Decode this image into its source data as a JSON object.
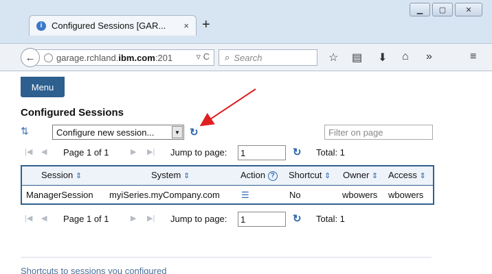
{
  "browser": {
    "tab_title": "Configured Sessions [GAR...",
    "tab_close": "×",
    "new_tab": "+",
    "url_prefix": "garage.rchland.",
    "url_host": "ibm.com",
    "url_suffix": ":201",
    "search_placeholder": "Search"
  },
  "page": {
    "menu_label": "Menu",
    "title": "Configured Sessions",
    "session_select": "Configure new session...",
    "filter_placeholder": "Filter on page",
    "pager_top": {
      "page": "Page 1 of 1",
      "jump_label": "Jump to page:",
      "jump_value": "1",
      "total": "Total: 1"
    },
    "pager_bottom": {
      "page": "Page 1 of 1",
      "jump_label": "Jump to page:",
      "jump_value": "1",
      "total": "Total: 1"
    },
    "table": {
      "headers": {
        "session": "Session",
        "system": "System",
        "action": "Action",
        "shortcut": "Shortcut",
        "owner": "Owner",
        "access": "Access"
      },
      "rows": [
        {
          "session": "ManagerSession",
          "system": "myiSeries.myCompany.com",
          "shortcut": "No",
          "owner": "wbowers",
          "access": "wbowers"
        }
      ]
    },
    "shortcuts_text": "Shortcuts to sessions you configured"
  },
  "colors": {
    "accent": "#2d5f8f",
    "annotation_arrow": "#e02020"
  }
}
